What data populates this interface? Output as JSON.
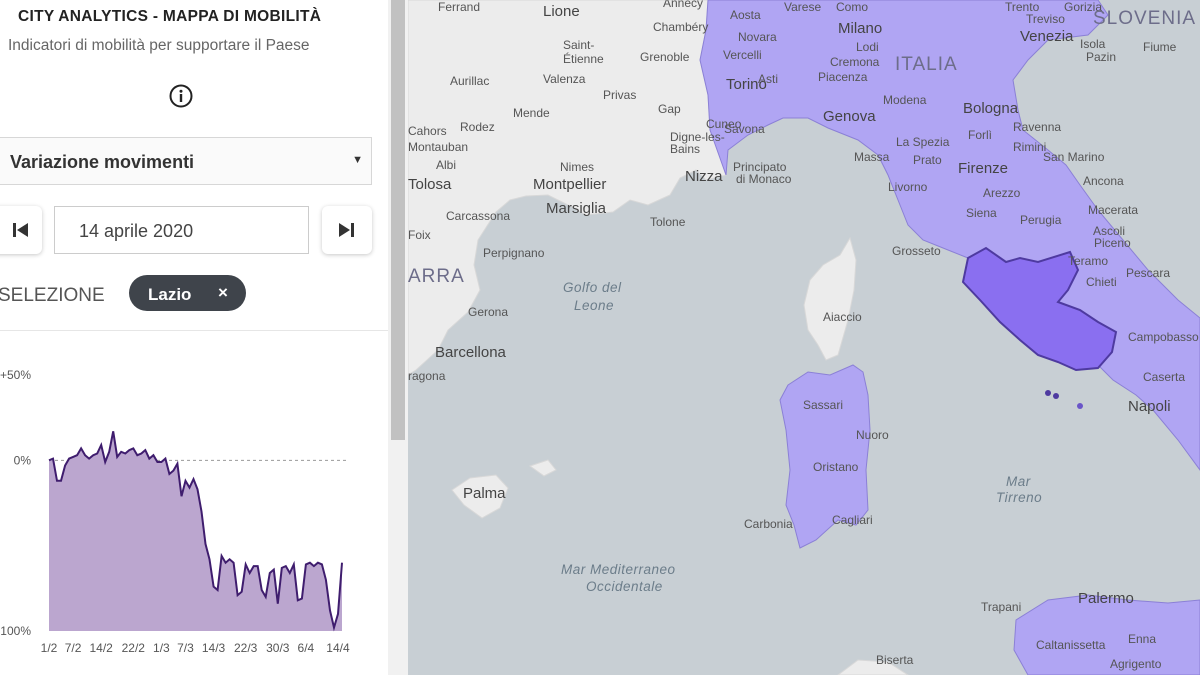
{
  "app": {
    "title": "CITY ANALYTICS - MAPPA DI MOBILITÀ",
    "subtitle": "Indicatori di mobilità per supportare il Paese",
    "info_icon": "info-circle-icon"
  },
  "controls": {
    "indicator_select": {
      "value": "Variazione movimenti",
      "arrow": "▼"
    },
    "date": "14 aprile 2020",
    "prev_icon": "skip-previous-icon",
    "next_icon": "skip-next-icon"
  },
  "selection": {
    "label": "SELEZIONE",
    "chip_label": "Lazio",
    "chip_close": "×"
  },
  "colors": {
    "chart_fill": "#bba6cf",
    "chart_line": "#3f1d6e",
    "region_fill": "#b0a5f3",
    "selected_region_fill": "#8a6ff0",
    "sea": "#c8cfd4",
    "land": "#ededed"
  },
  "chart_data": {
    "type": "area",
    "ylim": [
      -100,
      50
    ],
    "yticks": [
      {
        "value": 50,
        "label": "+50%"
      },
      {
        "value": 0,
        "label": "0%"
      },
      {
        "value": -100,
        "label": "-100%"
      }
    ],
    "x_tick_labels": [
      "1/2",
      "7/2",
      "14/2",
      "22/2",
      "1/3",
      "7/3",
      "14/3",
      "22/3",
      "30/3",
      "6/4",
      "14/4"
    ],
    "x_tick_days": [
      1,
      7,
      14,
      22,
      29,
      35,
      42,
      50,
      58,
      65,
      73
    ],
    "days": [
      1,
      2,
      3,
      4,
      5,
      6,
      7,
      8,
      9,
      10,
      11,
      12,
      13,
      14,
      15,
      16,
      17,
      18,
      19,
      20,
      21,
      22,
      23,
      24,
      25,
      26,
      27,
      28,
      29,
      30,
      31,
      32,
      33,
      34,
      35,
      36,
      37,
      38,
      39,
      40,
      41,
      42,
      43,
      44,
      45,
      46,
      47,
      48,
      49,
      50,
      51,
      52,
      53,
      54,
      55,
      56,
      57,
      58,
      59,
      60,
      61,
      62,
      63,
      64,
      65,
      66,
      67,
      68,
      69,
      70,
      71,
      72,
      73,
      74
    ],
    "values": [
      0,
      1,
      -12,
      -12,
      -3,
      1,
      2,
      3,
      7,
      3,
      1,
      3,
      4,
      9,
      -1,
      5,
      17,
      2,
      5,
      4,
      6,
      7,
      3,
      4,
      6,
      1,
      3,
      -1,
      -1,
      1,
      -8,
      -6,
      -2,
      -21,
      -12,
      -16,
      -11,
      -17,
      -30,
      -49,
      -58,
      -74,
      -76,
      -56,
      -60,
      -58,
      -60,
      -79,
      -77,
      -61,
      -66,
      -62,
      -62,
      -76,
      -80,
      -66,
      -64,
      -84,
      -63,
      -62,
      -66,
      -61,
      -82,
      -81,
      -61,
      -60,
      -62,
      -60,
      -61,
      -70,
      -88,
      -98,
      -90,
      -60
    ]
  },
  "map": {
    "labels": [
      {
        "text": "Ferrand",
        "type": "city"
      },
      {
        "text": "Lione",
        "type": "city-big"
      },
      {
        "text": "Annecy",
        "type": "city"
      },
      {
        "text": "Chambéry",
        "type": "city"
      },
      {
        "text": "Saint-",
        "type": "city"
      },
      {
        "text": "Étienne",
        "type": "city"
      },
      {
        "text": "Grenoble",
        "type": "city"
      },
      {
        "text": "Aurillac",
        "type": "city"
      },
      {
        "text": "Valenza",
        "type": "city"
      },
      {
        "text": "Privas",
        "type": "city"
      },
      {
        "text": "Gap",
        "type": "city"
      },
      {
        "text": "Rodez",
        "type": "city"
      },
      {
        "text": "Mende",
        "type": "city"
      },
      {
        "text": "Digne-les-",
        "type": "city"
      },
      {
        "text": "Bains",
        "type": "city"
      },
      {
        "text": "Albi",
        "type": "city"
      },
      {
        "text": "Nimes",
        "type": "city"
      },
      {
        "text": "Montpellier",
        "type": "city-big"
      },
      {
        "text": "Nizza",
        "type": "city-big"
      },
      {
        "text": "Marsiglia",
        "type": "city-big"
      },
      {
        "text": "Tolone",
        "type": "city"
      },
      {
        "text": "Carcassona",
        "type": "city"
      },
      {
        "text": "Perpignano",
        "type": "city"
      },
      {
        "text": "Gerona",
        "type": "city"
      },
      {
        "text": "Barcellona",
        "type": "city-big"
      },
      {
        "text": "Palma",
        "type": "city-big"
      },
      {
        "text": "Aosta",
        "type": "city"
      },
      {
        "text": "Novara",
        "type": "city"
      },
      {
        "text": "Vercelli",
        "type": "city"
      },
      {
        "text": "Torino",
        "type": "city-big"
      },
      {
        "text": "Asti",
        "type": "city"
      },
      {
        "text": "Cuneo",
        "type": "city"
      },
      {
        "text": "Savona",
        "type": "city"
      },
      {
        "text": "Milano",
        "type": "city-big"
      },
      {
        "text": "Lodi",
        "type": "city"
      },
      {
        "text": "Cremona",
        "type": "city"
      },
      {
        "text": "Piacenza",
        "type": "city"
      },
      {
        "text": "Genova",
        "type": "city-big"
      },
      {
        "text": "Varese",
        "type": "city"
      },
      {
        "text": "Como",
        "type": "city"
      },
      {
        "text": "ITALIA",
        "type": "country"
      },
      {
        "text": "Trento",
        "type": "city"
      },
      {
        "text": "Gorizia",
        "type": "city"
      },
      {
        "text": "Treviso",
        "type": "city"
      },
      {
        "text": "Venezia",
        "type": "city-big"
      },
      {
        "text": "SLOVENIA",
        "type": "country"
      },
      {
        "text": "Isola",
        "type": "city"
      },
      {
        "text": "Pazin",
        "type": "city"
      },
      {
        "text": "Fiume",
        "type": "city"
      },
      {
        "text": "Modena",
        "type": "city"
      },
      {
        "text": "Bologna",
        "type": "city-big"
      },
      {
        "text": "Ravenna",
        "type": "city"
      },
      {
        "text": "Forlì",
        "type": "city"
      },
      {
        "text": "Rimini",
        "type": "city"
      },
      {
        "text": "La Spezia",
        "type": "city"
      },
      {
        "text": "Massa",
        "type": "city"
      },
      {
        "text": "Prato",
        "type": "city"
      },
      {
        "text": "Firenze",
        "type": "city-big"
      },
      {
        "text": "Livorno",
        "type": "city"
      },
      {
        "text": "Arezzo",
        "type": "city"
      },
      {
        "text": "Siena",
        "type": "city"
      },
      {
        "text": "Perugia",
        "type": "city"
      },
      {
        "text": "San Marino",
        "type": "city"
      },
      {
        "text": "Ancona",
        "type": "city"
      },
      {
        "text": "Macerata",
        "type": "city"
      },
      {
        "text": "Ascoli",
        "type": "city"
      },
      {
        "text": "Piceno",
        "type": "city"
      },
      {
        "text": "Teramo",
        "type": "city"
      },
      {
        "text": "Pescara",
        "type": "city"
      },
      {
        "text": "Chieti",
        "type": "city"
      },
      {
        "text": "Grosseto",
        "type": "city"
      },
      {
        "text": "Campobasso",
        "type": "city"
      },
      {
        "text": "Caserta",
        "type": "city"
      },
      {
        "text": "Napoli",
        "type": "city-big"
      },
      {
        "text": "Principato",
        "type": "city"
      },
      {
        "text": "di Monaco",
        "type": "city"
      },
      {
        "text": "Aiaccio",
        "type": "city"
      },
      {
        "text": "Sassari",
        "type": "city"
      },
      {
        "text": "Nuoro",
        "type": "city"
      },
      {
        "text": "Oristano",
        "type": "city"
      },
      {
        "text": "Carbonia",
        "type": "city"
      },
      {
        "text": "Cagliari",
        "type": "city"
      },
      {
        "text": "Palermo",
        "type": "city-big"
      },
      {
        "text": "Trapani",
        "type": "city"
      },
      {
        "text": "Caltanissetta",
        "type": "city"
      },
      {
        "text": "Enna",
        "type": "city"
      },
      {
        "text": "Agrigento",
        "type": "city"
      },
      {
        "text": "Biserta",
        "type": "city"
      },
      {
        "text": "Golfo del",
        "type": "sea"
      },
      {
        "text": "Leone",
        "type": "sea"
      },
      {
        "text": "Mar",
        "type": "sea"
      },
      {
        "text": "Tirreno",
        "type": "sea"
      },
      {
        "text": "Mar Mediterraneo",
        "type": "sea"
      },
      {
        "text": "Occidentale",
        "type": "sea"
      },
      {
        "text": "Foix",
        "type": "city"
      },
      {
        "text": "Tolosa",
        "type": "city-big"
      },
      {
        "text": "Montauban",
        "type": "city"
      },
      {
        "text": "Cahors",
        "type": "city"
      },
      {
        "text": "ARRA",
        "type": "country"
      },
      {
        "text": "ragona",
        "type": "city"
      }
    ]
  }
}
